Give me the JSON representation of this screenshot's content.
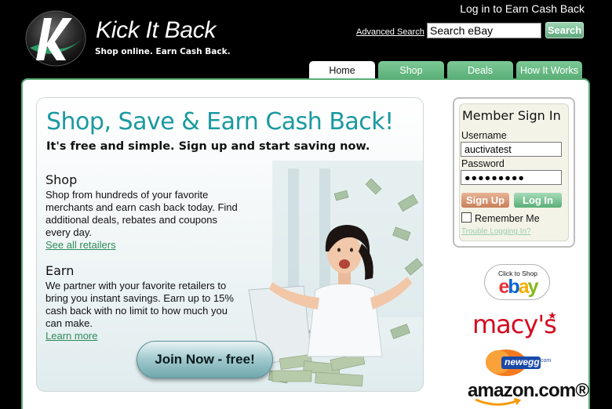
{
  "header": {
    "brand_name": "Kick It Back",
    "tagline": "Shop online. Earn Cash Back.",
    "login_link": "Log in to Earn Cash Back",
    "advanced_search": "Advanced Search",
    "search_value": "Search eBay",
    "search_button": "Search"
  },
  "tabs": [
    {
      "label": "Home",
      "active": true
    },
    {
      "label": "Shop",
      "active": false
    },
    {
      "label": "Deals",
      "active": false
    },
    {
      "label": "How It Works",
      "active": false
    }
  ],
  "hero": {
    "title": "Shop, Save & Earn Cash Back!",
    "subtitle": "It's free and simple. Sign up and start saving now.",
    "shop": {
      "heading": "Shop",
      "body": "Shop from hundreds of your favorite merchants and earn cash back today. Find additional deals, rebates and coupons every day.",
      "link": "See all retailers"
    },
    "earn": {
      "heading": "Earn",
      "body": "We partner with your favorite retailers to bring you instant savings. Earn up to 15% cash back with no limit to how much you can make.",
      "link": "Learn more"
    },
    "cta": "Join Now - free!"
  },
  "signin": {
    "title": "Member Sign In",
    "username_label": "Username",
    "username_value": "auctivatest",
    "password_label": "Password",
    "password_value": "●●●●●●●●●",
    "signup_button": "Sign Up",
    "login_button": "Log In",
    "remember_label": "Remember Me",
    "remember_checked": false,
    "trouble_link": "Trouble Logging In?"
  },
  "merchants": {
    "ebay_caption": "Click to Shop",
    "ebay_letters": [
      {
        "ch": "e",
        "color": "#e53238"
      },
      {
        "ch": "b",
        "color": "#0064d2"
      },
      {
        "ch": "a",
        "color": "#f5af02"
      },
      {
        "ch": "y",
        "color": "#86b817"
      }
    ],
    "macys": "macy's",
    "newegg": "newegg",
    "newegg_suffix": ".com",
    "amazon": "amazon.com®"
  },
  "colors": {
    "accent_green": "#5aae77",
    "title_teal": "#1a9aa0",
    "link_green": "#2f8a5a"
  }
}
